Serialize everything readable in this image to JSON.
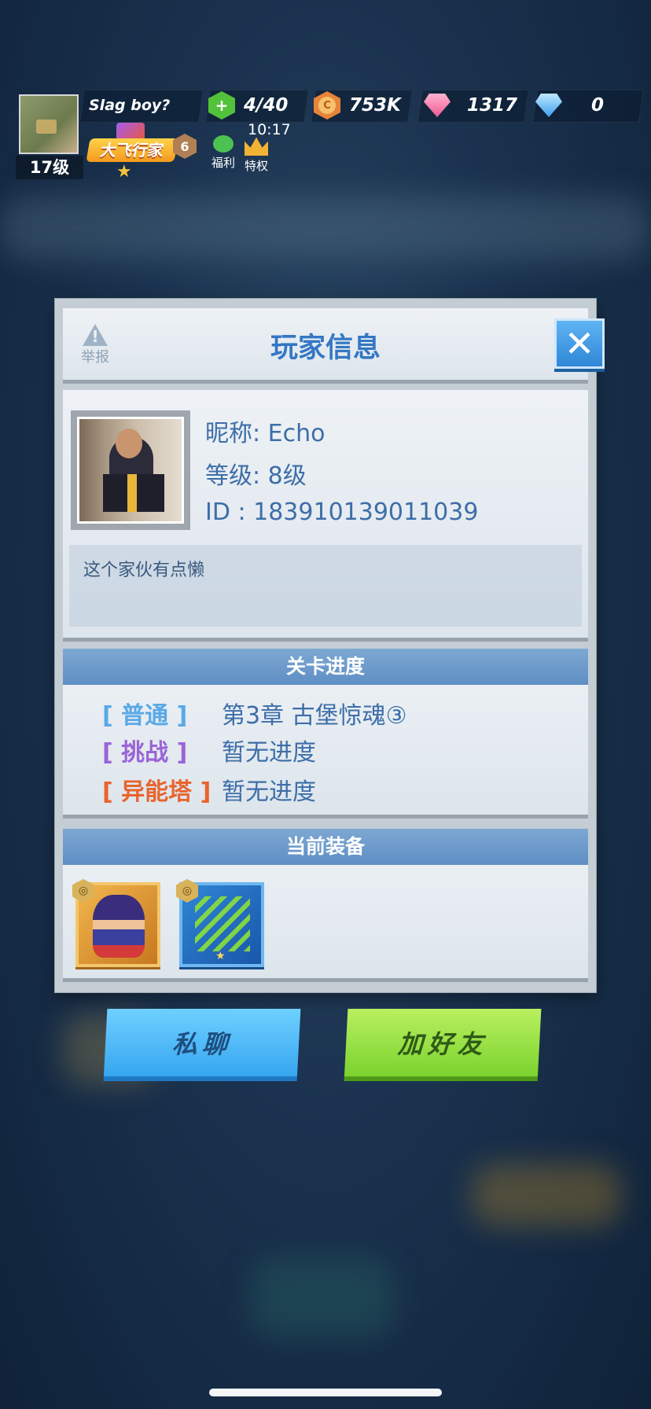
{
  "hud": {
    "player_name": "Slag boy?",
    "player_level": "17级",
    "energy": "4/40",
    "coins": "753K",
    "pink_gems": "1317",
    "blue_gems": "0",
    "timer": "10:17",
    "vip_logo_text": "大飞行家",
    "rank_number": "6",
    "welfare_label": "福利",
    "privilege_label": "特权",
    "icons": {
      "energy": "energy-plus-icon",
      "coin": "coin-icon",
      "pink_gem": "pink-gem-icon",
      "blue_gem": "blue-diamond-plus-icon",
      "welfare": "wechat-icon",
      "privilege": "crown-icon"
    }
  },
  "modal": {
    "title": "玩家信息",
    "report_label": "举报",
    "close_symbol": "✕",
    "profile": {
      "nickname_line": "昵称: Echo",
      "level_line": "等级:  8级",
      "id_line": "ID   :  183910139011039",
      "bio": "这个家伙有点懒"
    },
    "progress": {
      "section_title": "关卡进度",
      "rows": [
        {
          "label": "[ 普通 ]",
          "value": "第3章  古堡惊魂③",
          "color": "#5aa9e6"
        },
        {
          "label": "[ 挑战 ]",
          "value": "暂无进度",
          "color": "#9a64d6"
        },
        {
          "label": "[ 异能塔 ]",
          "value": "暂无进度",
          "color": "#e8642e"
        }
      ]
    },
    "equipment": {
      "section_title": "当前装备",
      "items": [
        {
          "name": "hero-ninja",
          "quality_badge": "◎"
        },
        {
          "name": "weapon-green-blades",
          "quality_badge": "◎"
        }
      ]
    }
  },
  "buttons": {
    "private_chat": "私聊",
    "add_friend": "加好友"
  }
}
